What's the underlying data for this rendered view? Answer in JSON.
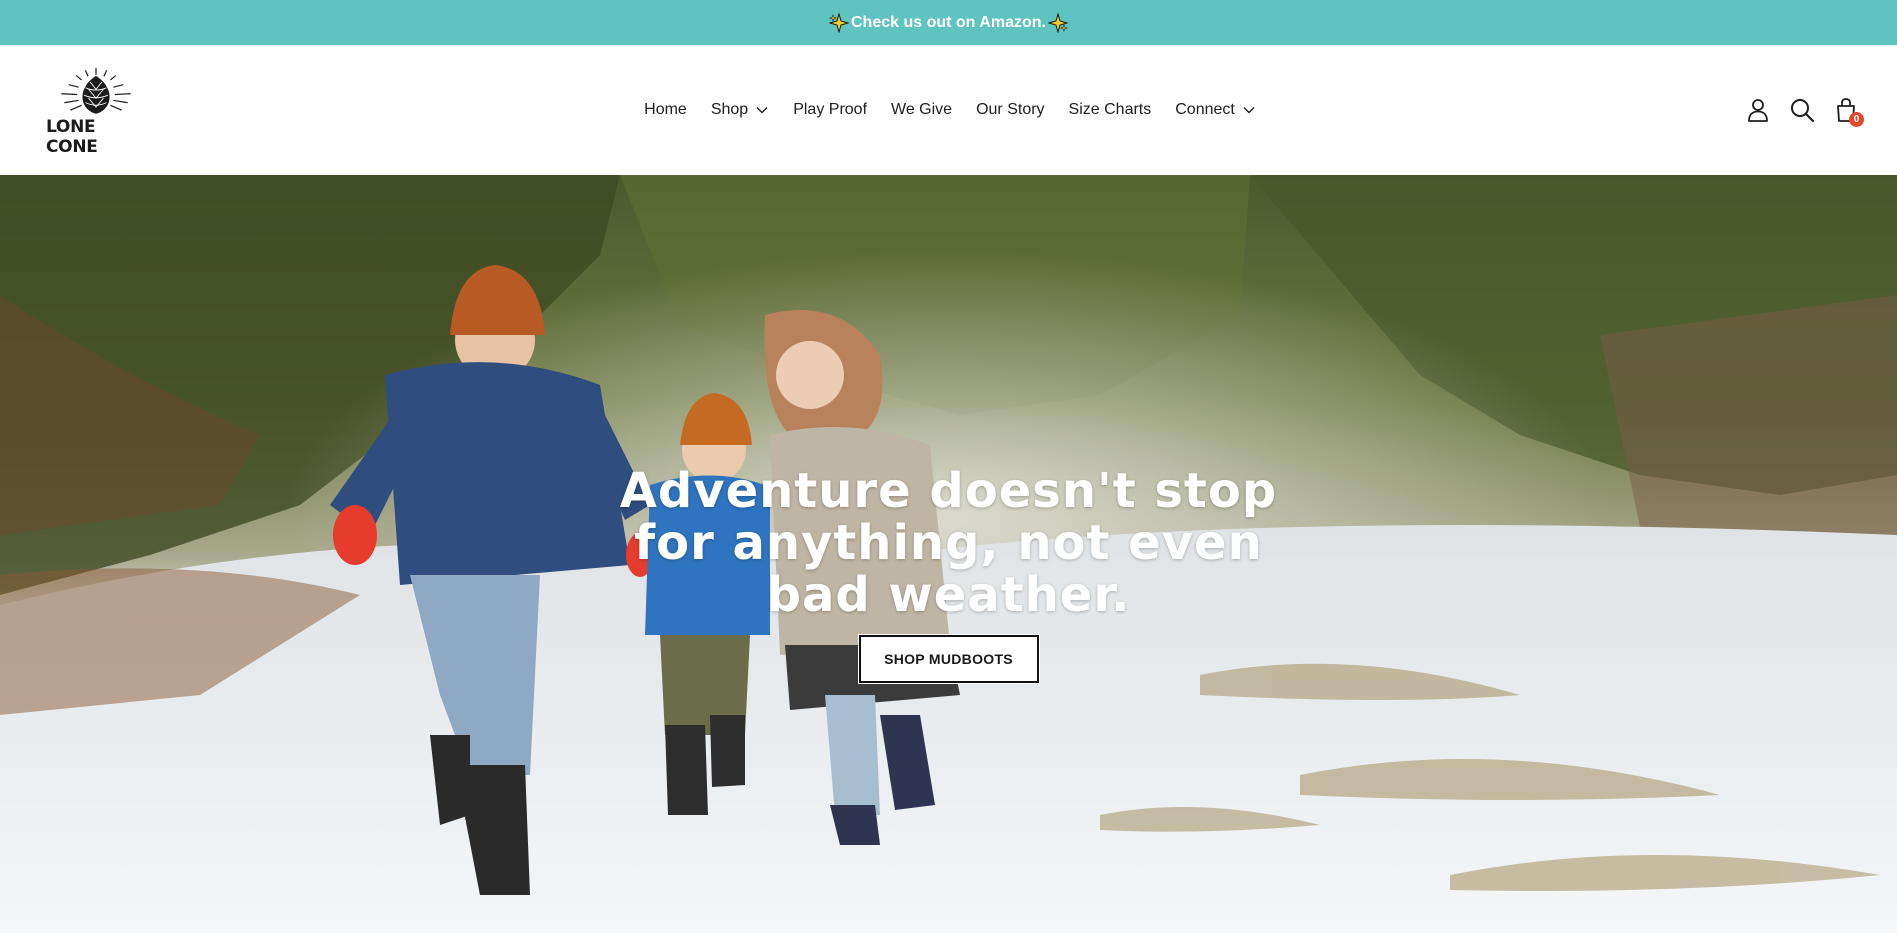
{
  "announcement": {
    "text": "Check us out on Amazon.",
    "icon": "sparkle-icon",
    "background": "#5fc4c0"
  },
  "header": {
    "logo_text": "LONE CONE",
    "nav": [
      {
        "label": "Home",
        "has_dropdown": false
      },
      {
        "label": "Shop",
        "has_dropdown": true
      },
      {
        "label": "Play Proof",
        "has_dropdown": false
      },
      {
        "label": "We Give",
        "has_dropdown": false
      },
      {
        "label": "Our Story",
        "has_dropdown": false
      },
      {
        "label": "Size Charts",
        "has_dropdown": false
      },
      {
        "label": "Connect",
        "has_dropdown": true
      }
    ],
    "icons": [
      "account-icon",
      "search-icon",
      "cart-icon"
    ],
    "cart_count": "0",
    "cart_badge_color": "#e8452f"
  },
  "hero": {
    "title": "Adventure doesn't stop for anything, not even bad weather.",
    "button_label": "SHOP MUDBOOTS"
  }
}
